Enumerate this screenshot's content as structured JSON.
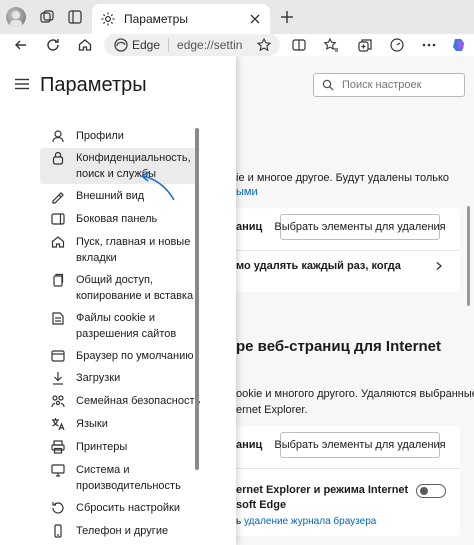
{
  "browser": {
    "tab_title": "Параметры",
    "edge_label": "Edge",
    "address_url": "edge://settin",
    "accent_color": "#0f6cbd"
  },
  "settings": {
    "title": "Параметры",
    "search_placeholder": "Поиск настроек",
    "nav_items": [
      {
        "label": "Профили",
        "icon": "profile-icon"
      },
      {
        "label": "Конфиденциальность,\nпоиск и службы",
        "icon": "lock-icon",
        "active": true
      },
      {
        "label": "Внешний вид",
        "icon": "appearance-icon"
      },
      {
        "label": "Боковая панель",
        "icon": "sidebar-icon"
      },
      {
        "label": "Пуск, главная и новые\nвкладки",
        "icon": "home-icon"
      },
      {
        "label": "Общий доступ,\nкопирование и вставка",
        "icon": "share-icon"
      },
      {
        "label": "Файлы cookie и\nразрешения сайтов",
        "icon": "cookie-icon"
      },
      {
        "label": "Браузер по умолчанию",
        "icon": "browser-icon"
      },
      {
        "label": "Загрузки",
        "icon": "download-icon"
      },
      {
        "label": "Семейная безопасность",
        "icon": "family-icon"
      },
      {
        "label": "Языки",
        "icon": "language-icon"
      },
      {
        "label": "Принтеры",
        "icon": "printer-icon"
      },
      {
        "label": "Система и\nпроизводительность",
        "icon": "system-icon"
      },
      {
        "label": "Сбросить настройки",
        "icon": "reset-icon"
      },
      {
        "label": "Телефон и другие",
        "icon": "phone-icon"
      }
    ]
  },
  "main": {
    "line1": "ie и многое другое. Будут удалены только",
    "line1_link": "ыми",
    "card1_label": "аниц",
    "card1_button": "Выбрать элементы для удаления",
    "card1_row2": "мо удалять каждый раз, когда",
    "section2_title": "ре веб-страниц для Internet",
    "section2_line1": "ookie и многого другого. Удаляются выбранные",
    "section2_line2": "ernet Explorer.",
    "card2_label": "аниц",
    "card2_button": "Выбрать элементы для удаления",
    "card2_row2a": "ernet Explorer и режима Internet",
    "card2_row2b": "soft Edge",
    "card2_row2c_prefix": "ь",
    "card2_row2c_link": "удаление журнала браузера",
    "toggle_on": false
  }
}
